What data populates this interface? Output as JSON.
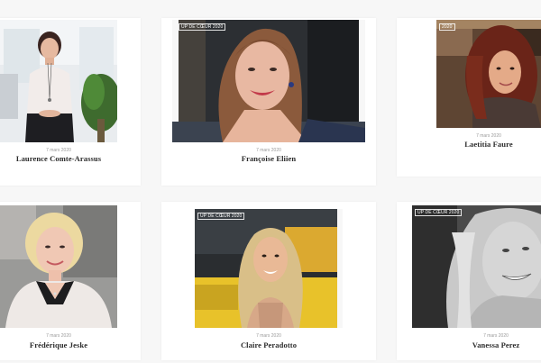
{
  "posts": [
    {
      "date": "7 mars 2020",
      "name": "Laurence Comte-Arassus",
      "badge": "",
      "photo": "portrait-woman-office"
    },
    {
      "date": "7 mars 2020",
      "name": "Françoise Eliien",
      "badge": "UP DE CŒUR 2020",
      "photo": "portrait-woman-smiling"
    },
    {
      "date": "7 mars 2020",
      "name": "Laetitia Faure",
      "badge": "2020",
      "photo": "portrait-woman-curly-hair"
    },
    {
      "date": "7 mars 2020",
      "name": "Frédérique Jeske",
      "badge": "",
      "photo": "portrait-woman-blonde-short"
    },
    {
      "date": "7 mars 2020",
      "name": "Claire Peradotto",
      "badge": "UP DE CŒUR 2020",
      "photo": "portrait-woman-blonde-long"
    },
    {
      "date": "7 mars 2020",
      "name": "Vanessa Perez",
      "badge": "UP DE CŒUR 2020",
      "photo": "portrait-woman-bw"
    }
  ]
}
